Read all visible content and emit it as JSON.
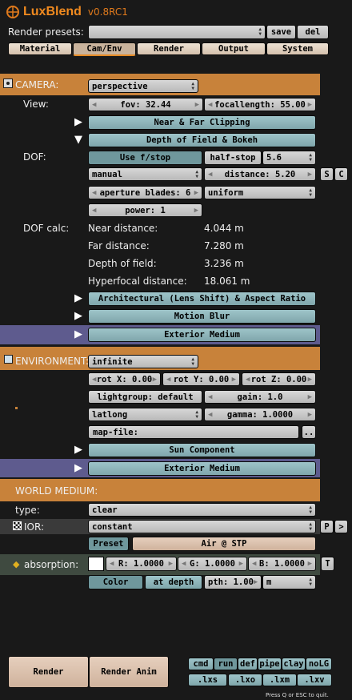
{
  "header": {
    "logo": "LuxBlend",
    "version": "v0.8RC1"
  },
  "presets": {
    "label": "Render presets:",
    "value": "",
    "save": "save",
    "del": "del"
  },
  "tabs": [
    "Material",
    "Cam/Env",
    "Render",
    "Output",
    "System"
  ],
  "camera": {
    "title": "CAMERA:",
    "type": "perspective",
    "view_label": "View:",
    "fov": "fov: 32.44",
    "focallength": "focallength: 55.00",
    "clipping": "Near & Far Clipping",
    "dof_bokeh": "Depth of Field & Bokeh",
    "dof_label": "DOF:",
    "use_fstop": "Use f/stop",
    "half_stop": "half-stop",
    "fstop": "5.6",
    "focus_mode": "manual",
    "distance": "distance: 5.20",
    "s": "S",
    "c": "C",
    "aperture_blades": "aperture blades: 6",
    "distribution": "uniform",
    "power": "power: 1",
    "dofcalc_label": "DOF calc:",
    "calc": [
      {
        "name": "Near distance:",
        "value": "4.044 m"
      },
      {
        "name": "Far distance:",
        "value": "7.280 m"
      },
      {
        "name": "Depth of field:",
        "value": "3.236 m"
      },
      {
        "name": "Hyperfocal distance:",
        "value": "18.061 m"
      }
    ],
    "arch": "Architectural (Lens Shift) & Aspect Ratio",
    "motion_blur": "Motion Blur",
    "exterior_medium": "Exterior Medium"
  },
  "environment": {
    "title": "ENVIRONMENT:",
    "type": "infinite",
    "rotx": "rot X: 0.00",
    "roty": "rot Y: 0.00",
    "rotz": "rot Z: 0.00",
    "lightgroup": "lightgroup: default",
    "gain": "gain: 1.0",
    "mapping": "latlong",
    "gamma": "gamma: 1.0000",
    "mapfile": "map-file:",
    "browse": "..",
    "sun": "Sun Component",
    "exterior_medium": "Exterior Medium"
  },
  "world": {
    "title": "WORLD MEDIUM:",
    "type_label": "type:",
    "type": "clear",
    "ior_label": "IOR:",
    "ior_mode": "constant",
    "p": "P",
    "more": ">",
    "preset": "Preset",
    "preset_value": "Air @ STP",
    "absorption_label": "absorption:",
    "r": "R: 1.0000",
    "g": "G: 1.0000",
    "b": "B: 1.0000",
    "t": "T",
    "color": "Color",
    "at_depth": "at depth",
    "depth": "pth: 1.00",
    "unit": "m"
  },
  "bottom": {
    "render": "Render",
    "render_anim": "Render Anim",
    "modes": [
      "cmd",
      "run",
      "def",
      "pipe",
      "clay",
      "noLG"
    ],
    "exports": [
      ".lxs",
      ".lxo",
      ".lxm",
      ".lxv"
    ],
    "quit": "Press Q or ESC to quit."
  }
}
